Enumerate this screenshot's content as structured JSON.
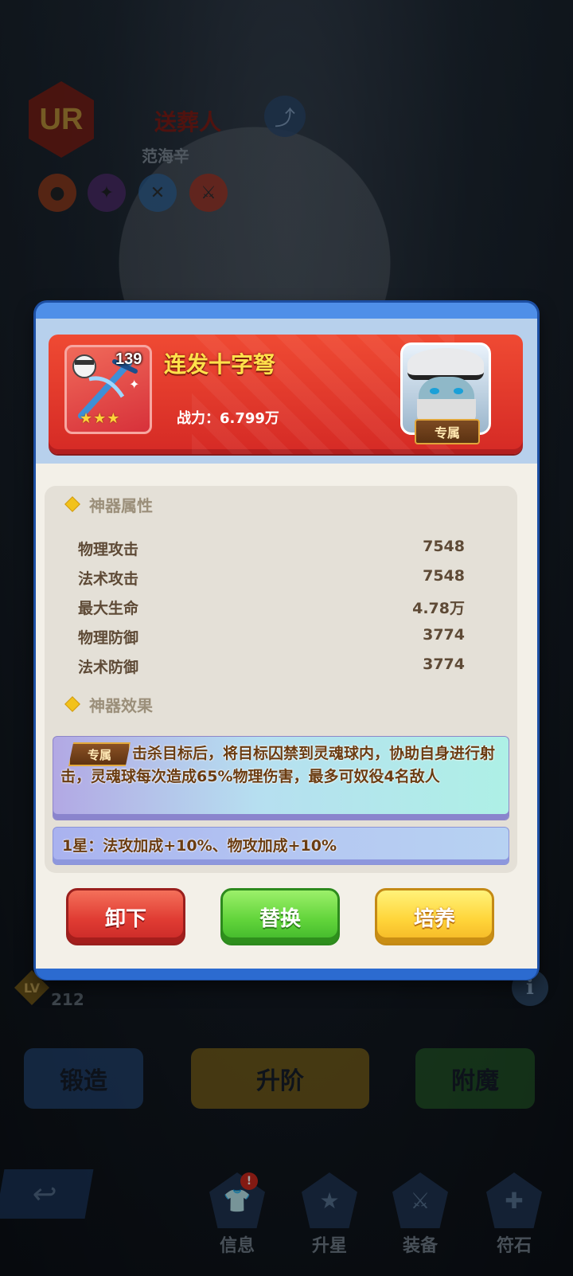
{
  "background": {
    "rarity": "UR",
    "hero_title": "送葬人",
    "hero_name": "范海辛",
    "share_icon": "share-icon",
    "level_label": "LV",
    "level_value": "212",
    "info_label": "i",
    "buttons": [
      "锻造",
      "升阶",
      "附魔"
    ],
    "tabs": [
      {
        "label": "信息",
        "icon": "info-tab-icon",
        "badge": "!"
      },
      {
        "label": "升星",
        "icon": "star-tab-icon"
      },
      {
        "label": "装备",
        "icon": "equipment-tab-icon"
      },
      {
        "label": "符石",
        "icon": "rune-tab-icon"
      }
    ],
    "back_icon": "back-arrow-icon"
  },
  "modal": {
    "item": {
      "level": "139",
      "stars": "★★★",
      "name": "连发十字弩",
      "power": "战力：6.799万",
      "owner_tag": "专属"
    },
    "attributes_title": "神器属性",
    "attributes": [
      {
        "label": "物理攻击",
        "value": "7548"
      },
      {
        "label": "法术攻击",
        "value": "7548"
      },
      {
        "label": "最大生命",
        "value": "4.78万"
      },
      {
        "label": "物理防御",
        "value": "3774"
      },
      {
        "label": "法术防御",
        "value": "3774"
      }
    ],
    "effects_title": "神器效果",
    "effect_tag": "专属",
    "effect_text": "击杀目标后，将目标囚禁到灵魂球内，协助自身进行射击，灵魂球每次造成65%物理伤害，最多可奴役4名敌人",
    "star_bonus": "1星：法攻加成+10%、物攻加成+10%",
    "buttons": {
      "unequip": "卸下",
      "replace": "替换",
      "upgrade": "培养"
    }
  },
  "colors": {
    "header_red": "#e0382c",
    "item_name": "#ffe14b",
    "frame_blue": "#2c6bd0",
    "btn_red": "#e03c33",
    "btn_green": "#62d43b",
    "btn_yellow": "#ffd53a"
  }
}
